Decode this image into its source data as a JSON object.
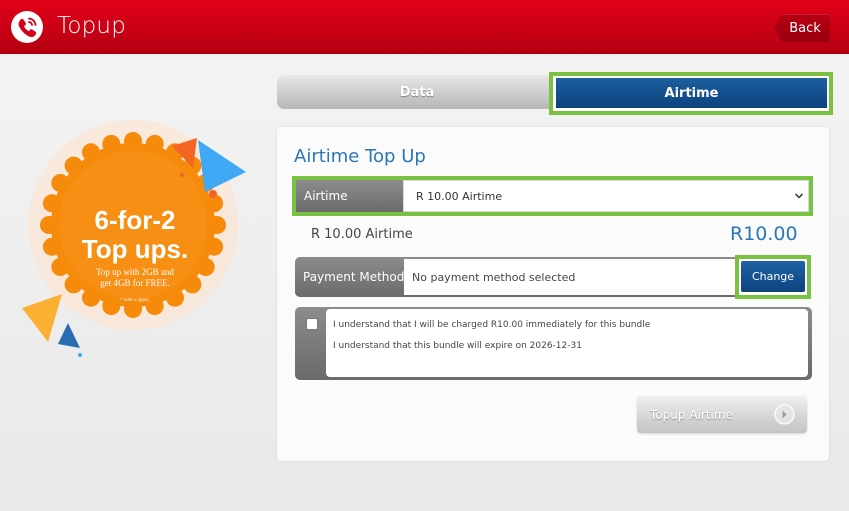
{
  "header": {
    "title": "Topup",
    "back_label": "Back",
    "brand_color": "#d4001a"
  },
  "promo": {
    "line1": "6-for-2",
    "line2": "Top ups.",
    "line3": "Top up with 2GB and",
    "line4": "get 4GB for FREE.",
    "fine_print": "*Ts&Cs apply.",
    "badge_color": "#f58a0b"
  },
  "tabs": [
    {
      "label": "Data",
      "active": false
    },
    {
      "label": "Airtime",
      "active": true
    }
  ],
  "form": {
    "title": "Airtime Top Up",
    "airtime_label": "Airtime",
    "airtime_selected": "R 10.00 Airtime",
    "summary_label": "R 10.00 Airtime",
    "summary_amount": "R10.00",
    "payment_label": "Payment Method",
    "payment_value": "No payment method selected",
    "change_label": "Change",
    "terms": {
      "line1": "I understand that I will be charged R10.00 immediately for this bundle",
      "line2": "I understand that this bundle will expire on 2026-12-31",
      "checked": false
    },
    "submit_label": "Topup Airtime"
  },
  "colors": {
    "accent_blue": "#0d427e",
    "highlight_green": "#7ac142",
    "title_blue": "#2a77b8"
  }
}
